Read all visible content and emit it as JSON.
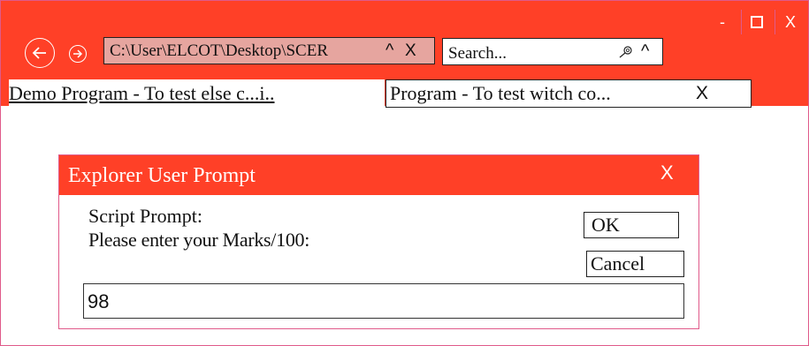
{
  "window": {
    "minimize": "-",
    "close": "X"
  },
  "toolbar": {
    "address_value": "C:\\User\\ELCOT\\Desktop\\SCER",
    "address_caret": "^",
    "address_clear": "X",
    "search_placeholder": "Search...",
    "search_caret": "^"
  },
  "tabs": [
    {
      "label": "Demo Program - To test else c...i.."
    },
    {
      "label": "Program - To test witch co...",
      "close": "X"
    }
  ],
  "dialog": {
    "title": "Explorer User Prompt",
    "close": "X",
    "line1": "Script Prompt:",
    "line2": "Please enter your Marks/100:",
    "ok_label": "OK",
    "cancel_label": "Cancel",
    "input_value": "98"
  },
  "colors": {
    "accent": "#ff4027",
    "address_bg": "#e6a59f",
    "border_pink": "#e05a8a"
  },
  "icons": [
    "back-arrow-icon",
    "forward-arrow-icon",
    "search-icon",
    "maximize-icon"
  ]
}
